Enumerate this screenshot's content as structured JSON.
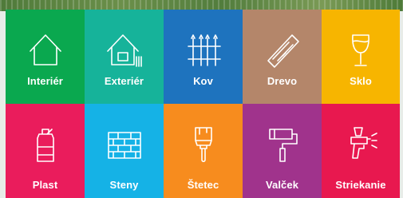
{
  "tiles": [
    {
      "label": "Interiér",
      "color": "#0aa84f",
      "icon": "house-icon"
    },
    {
      "label": "Exteriér",
      "color": "#16b39a",
      "icon": "house-fence-icon"
    },
    {
      "label": "Kov",
      "color": "#1e73be",
      "icon": "metal-fence-icon"
    },
    {
      "label": "Drevo",
      "color": "#b4866a",
      "icon": "wood-plank-icon"
    },
    {
      "label": "Sklo",
      "color": "#f7b500",
      "icon": "wine-glass-icon"
    },
    {
      "label": "Plast",
      "color": "#ea1c5c",
      "icon": "plastic-bottle-icon"
    },
    {
      "label": "Steny",
      "color": "#15b2e6",
      "icon": "brick-wall-icon"
    },
    {
      "label": "Štetec",
      "color": "#f78c1e",
      "icon": "paint-brush-icon"
    },
    {
      "label": "Valček",
      "color": "#a0338c",
      "icon": "paint-roller-icon"
    },
    {
      "label": "Striekanie",
      "color": "#e8184f",
      "icon": "spray-gun-icon"
    }
  ]
}
